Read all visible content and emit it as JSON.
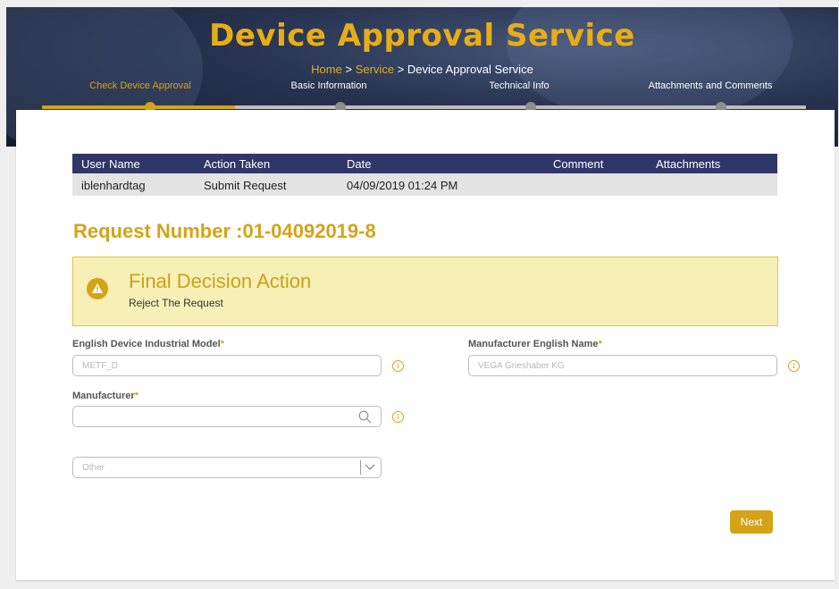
{
  "header": {
    "title": "Device Approval Service",
    "breadcrumb": {
      "home": "Home",
      "sep1": ">",
      "service": "Service",
      "sep2": ">",
      "current": "Device Approval Service"
    }
  },
  "steps": [
    {
      "label": "Check Device Approval",
      "active": true
    },
    {
      "label": "Basic Information",
      "active": false
    },
    {
      "label": "Technical Info",
      "active": false
    },
    {
      "label": "Attachments and Comments",
      "active": false
    }
  ],
  "history_table": {
    "headers": [
      "User Name",
      "Action Taken",
      "Date",
      "Comment",
      "Attachments"
    ],
    "rows": [
      [
        "iblenhardtag",
        "Submit Request",
        "04/09/2019 01:24 PM",
        "",
        ""
      ]
    ]
  },
  "request": {
    "label": "Request Number :01-04092019-8"
  },
  "alert": {
    "title": "Final Decision Action",
    "message": "Reject The Request",
    "icon": "warning-triangle-icon"
  },
  "form": {
    "english_model": {
      "label": "English Device Industrial Model",
      "required": "*",
      "placeholder": "METF_D"
    },
    "manufacturer_english_name": {
      "label": "Manufacturer English Name",
      "required": "*",
      "placeholder": "VEGA Grieshaber KG"
    },
    "manufacturer": {
      "label": "Manufacturer",
      "required": "*",
      "placeholder": ""
    },
    "other_select": {
      "value": "Other"
    }
  },
  "actions": {
    "next_label": "Next"
  },
  "colors": {
    "accent": "#d4a316",
    "table_header": "#2f3769",
    "alert_bg": "#f6efb6"
  }
}
